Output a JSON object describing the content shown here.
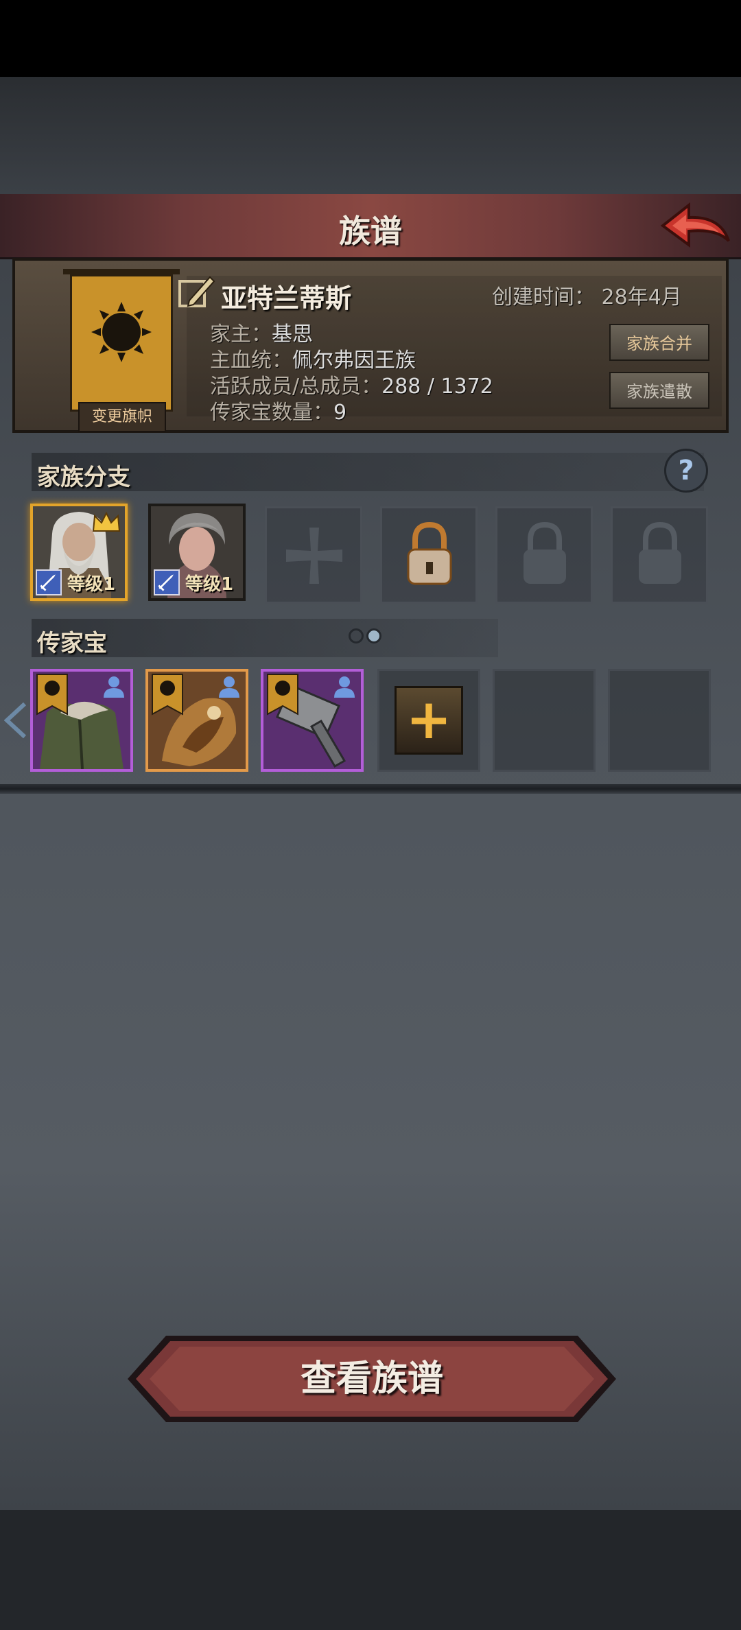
{
  "header": {
    "title": "族谱"
  },
  "family": {
    "name": "亚特兰蒂斯",
    "change_banner_label": "变更旗帜",
    "created_label": "创建时间：",
    "created_value": "28年4月",
    "leader_label": "家主：",
    "leader_value": "基思",
    "bloodline_label": "主血统：",
    "bloodline_value": "佩尔弗因王族",
    "members_label": "活跃成员/总成员：",
    "members_value": "288 / 1372",
    "heirloom_count_label": "传家宝数量：",
    "heirloom_count_value": "9",
    "merge_button": "家族合并",
    "disband_button": "家族遣散"
  },
  "branches": {
    "title": "家族分支",
    "help": "?",
    "members": [
      {
        "level": "等级1",
        "leader": true
      },
      {
        "level": "等级1",
        "leader": false
      }
    ],
    "empty_slots": [
      "cross-icon",
      "lock-icon-active",
      "lock-icon",
      "lock-icon"
    ]
  },
  "heirlooms": {
    "title": "传家宝",
    "items": [
      {
        "rarity": "purple",
        "icon": "fur-coat-icon"
      },
      {
        "rarity": "orange",
        "icon": "dragon-armor-icon"
      },
      {
        "rarity": "purple",
        "icon": "warhammer-icon"
      }
    ],
    "add_label": "+",
    "page_dots": 2,
    "active_dot": 1
  },
  "footer": {
    "view_button": "查看族谱"
  },
  "colors": {
    "accent_red": "#8a4842",
    "gold": "#e3a42a",
    "purple_rarity": "#b35ed8",
    "orange_rarity": "#e39a4a"
  }
}
